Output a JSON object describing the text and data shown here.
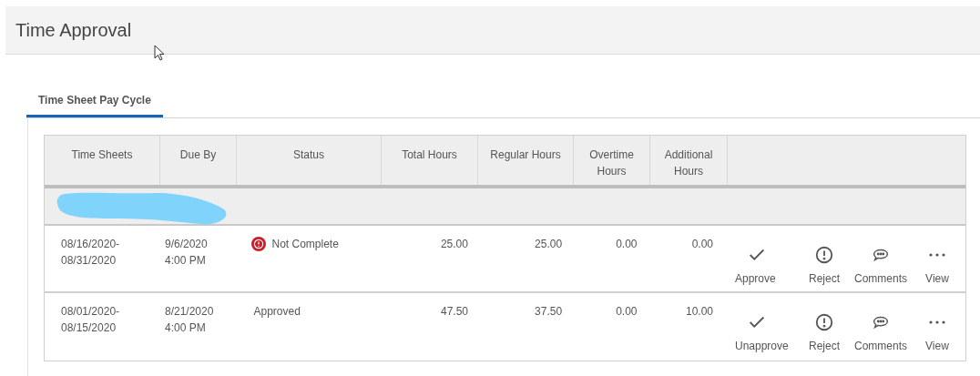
{
  "page": {
    "title": "Time Approval"
  },
  "tabs": [
    {
      "label": "Time Sheet Pay Cycle",
      "selected": true
    }
  ],
  "table": {
    "columns": [
      {
        "label": "Time Sheets"
      },
      {
        "label": "Due By"
      },
      {
        "label": "Status"
      },
      {
        "label": "Total Hours"
      },
      {
        "label": "Regular Hours"
      },
      {
        "label": "Overtime Hours"
      },
      {
        "label": "Additional Hours"
      }
    ],
    "rows": [
      {
        "period": [
          "08/16/2020-",
          "08/31/2020"
        ],
        "due": [
          "9/6/2020",
          "4:00 PM"
        ],
        "status": {
          "text": "Not Complete",
          "kind": "error"
        },
        "total": "25.00",
        "regular": "25.00",
        "overtime": "0.00",
        "additional": "0.00",
        "actions": [
          {
            "kind": "approve",
            "label": "Approve"
          },
          {
            "kind": "reject",
            "label": "Reject"
          },
          {
            "kind": "comments",
            "label": "Comments"
          },
          {
            "kind": "view",
            "label": "View"
          }
        ]
      },
      {
        "period": [
          "08/01/2020-",
          "08/15/2020"
        ],
        "due": [
          "8/21/2020",
          "4:00 PM"
        ],
        "status": {
          "text": "Approved",
          "kind": "plain"
        },
        "total": "47.50",
        "regular": "37.50",
        "overtime": "0.00",
        "additional": "10.00",
        "actions": [
          {
            "kind": "approve",
            "label": "Unapprove"
          },
          {
            "kind": "reject",
            "label": "Reject"
          },
          {
            "kind": "comments",
            "label": "Comments"
          },
          {
            "kind": "view",
            "label": "View"
          }
        ]
      }
    ]
  }
}
